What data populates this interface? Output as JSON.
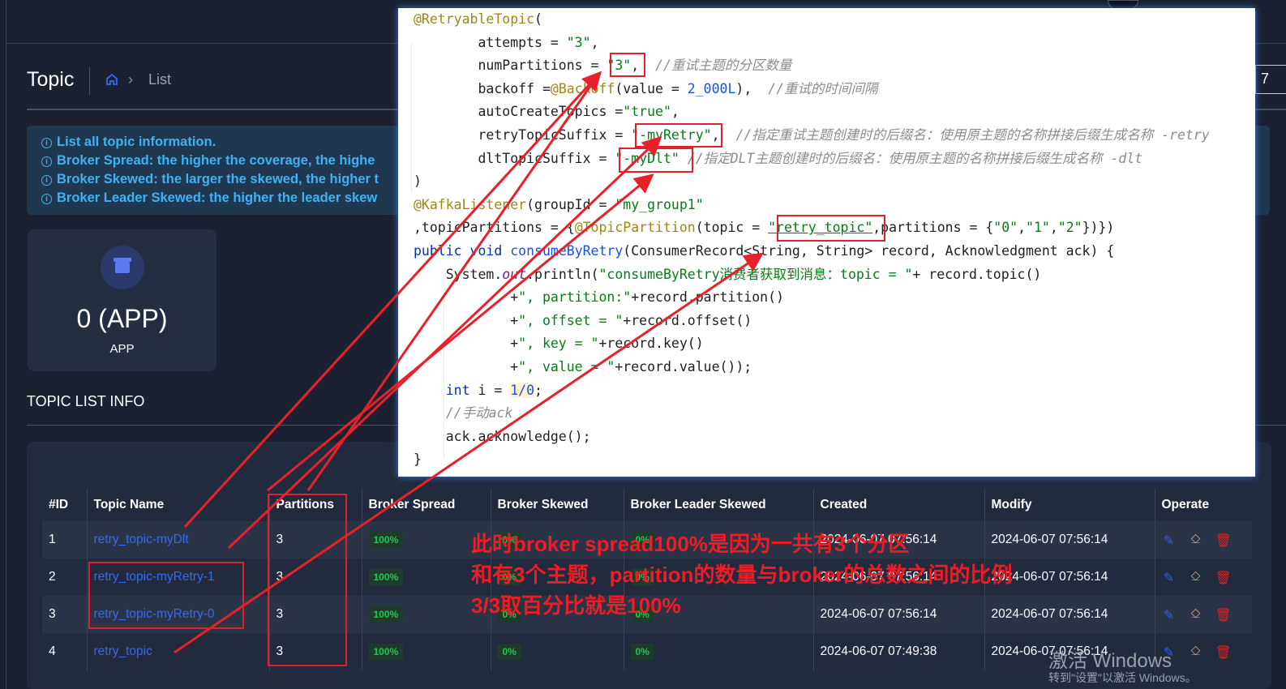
{
  "header": {
    "title": "Topic",
    "breadcrumb": [
      "home-icon",
      "List"
    ],
    "right_fragment": "7"
  },
  "alert": {
    "lines": [
      "List all topic information.",
      "Broker Spread: the higher the coverage, the highe",
      "Broker Skewed: the larger the skewed, the higher t",
      "Broker Leader Skewed: the higher the leader skew"
    ]
  },
  "app_card": {
    "value": "0 (APP)",
    "label": "APP",
    "icon": "archive-icon"
  },
  "section_title": "TOPIC LIST INFO",
  "table": {
    "columns": [
      "#ID",
      "Topic Name",
      "Partitions",
      "Broker Spread",
      "Broker Skewed",
      "Broker Leader Skewed",
      "Created",
      "Modify",
      "Operate"
    ],
    "rows": [
      {
        "id": "1",
        "name": "retry_topic-myDlt",
        "partitions": "3",
        "spread": "100%",
        "skewed": "0%",
        "leader_skewed": "0%",
        "created": "2024-06-07 07:56:14",
        "modify": "2024-06-07 07:56:14"
      },
      {
        "id": "2",
        "name": "retry_topic-myRetry-1",
        "partitions": "3",
        "spread": "100%",
        "skewed": "0%",
        "leader_skewed": "0%",
        "created": "2024-06-07 07:56:14",
        "modify": "2024-06-07 07:56:14"
      },
      {
        "id": "3",
        "name": "retry_topic-myRetry-0",
        "partitions": "3",
        "spread": "100%",
        "skewed": "0%",
        "leader_skewed": "0%",
        "created": "2024-06-07 07:56:14",
        "modify": "2024-06-07 07:56:14"
      },
      {
        "id": "4",
        "name": "retry_topic",
        "partitions": "3",
        "spread": "100%",
        "skewed": "0%",
        "leader_skewed": "0%",
        "created": "2024-06-07 07:49:38",
        "modify": "2024-06-07 07:56:14"
      }
    ],
    "operate_icons": [
      "edit-icon",
      "brush-icon",
      "delete-icon"
    ]
  },
  "code": {
    "lines": [
      [
        [
          "@RetryableTopic",
          "an"
        ],
        [
          "(",
          ""
        ]
      ],
      [
        [
          "        attempts = ",
          ""
        ],
        [
          "\"3\"",
          "s"
        ],
        [
          ",",
          ""
        ]
      ],
      [
        [
          "        numPartitions = ",
          ""
        ],
        [
          "\"3\"",
          "s"
        ],
        [
          ",  ",
          ""
        ],
        [
          "//重试主题的分区数量",
          "c"
        ]
      ],
      [
        [
          "        backoff =",
          ""
        ],
        [
          "@Backoff",
          "an"
        ],
        [
          "(value = ",
          ""
        ],
        [
          "2_000L",
          "n"
        ],
        [
          "),  ",
          ""
        ],
        [
          "//重试的时间间隔",
          "c"
        ]
      ],
      [
        [
          "        autoCreateTopics =",
          ""
        ],
        [
          "\"true\"",
          "s"
        ],
        [
          ",",
          ""
        ]
      ],
      [
        [
          "        retryTopicSuffix = ",
          ""
        ],
        [
          "\"-myRetry\"",
          "s"
        ],
        [
          ",  ",
          ""
        ],
        [
          "//指定重试主题创建时的后缀名：使用原主题的名称拼接后缀生成名称 -retry",
          "c"
        ]
      ],
      [
        [
          "        dltTopicSuffix = ",
          ""
        ],
        [
          "\"-myDlt\"",
          "s"
        ],
        [
          " ",
          ""
        ],
        [
          "//指定DLT主题创建时的后缀名：使用原主题的名称拼接后缀生成名称 -dlt",
          "c"
        ]
      ],
      [
        [
          ")",
          ""
        ]
      ],
      [
        [
          "@KafkaListener",
          "an"
        ],
        [
          "(groupId = ",
          ""
        ],
        [
          "\"my_group1\"",
          "s"
        ]
      ],
      [
        [
          ",topicPartitions = {",
          ""
        ],
        [
          "@TopicPartition",
          "an"
        ],
        [
          "(topic = ",
          ""
        ],
        [
          "\"retry_topic\"",
          "s ul"
        ],
        [
          ",partitions = {",
          ""
        ],
        [
          "\"0\"",
          "s"
        ],
        [
          ",",
          ""
        ],
        [
          "\"1\"",
          "s"
        ],
        [
          ",",
          ""
        ],
        [
          "\"2\"",
          "s"
        ],
        [
          "})})",
          ""
        ]
      ],
      [
        [
          "public void ",
          "k"
        ],
        [
          "consumeByRetry",
          "n"
        ],
        [
          "(ConsumerRecord<String, String> record, Acknowledgment ack) {",
          ""
        ]
      ],
      [
        [
          "    System.",
          ""
        ],
        [
          "out",
          "f"
        ],
        [
          ".println(",
          ""
        ],
        [
          "\"consumeByRetry消费者获取到消息：topic = \"",
          "s"
        ],
        [
          "+ record.topic()",
          ""
        ]
      ],
      [
        [
          "            +",
          ""
        ],
        [
          "\", partition:\"",
          "s"
        ],
        [
          "+record.partition()",
          ""
        ]
      ],
      [
        [
          "            +",
          ""
        ],
        [
          "\", offset = \"",
          "s"
        ],
        [
          "+record.offset()",
          ""
        ]
      ],
      [
        [
          "            +",
          ""
        ],
        [
          "\", key = \"",
          "s"
        ],
        [
          "+record.key()",
          ""
        ]
      ],
      [
        [
          "            +",
          ""
        ],
        [
          "\", value = \"",
          "s"
        ],
        [
          "+record.value());",
          ""
        ]
      ],
      [
        [
          "    ",
          ""
        ],
        [
          "int",
          "k"
        ],
        [
          " i = ",
          ""
        ],
        [
          "1/0",
          "n hl"
        ],
        [
          ";",
          ""
        ]
      ],
      [
        [
          "    ",
          ""
        ],
        [
          "//手动ack",
          "c"
        ]
      ],
      [
        [
          "    ack.acknowledge();",
          ""
        ]
      ],
      [
        [
          "}",
          ""
        ]
      ]
    ]
  },
  "annotation": {
    "lines": [
      "此时broker spread100%是因为一共有3个分区",
      "和有3个主题，partition的数量与broker的总数之间的比例",
      "3/3取百分比就是100%"
    ],
    "color": "#ee1c25"
  },
  "watermark": {
    "title": "激活 Windows",
    "subtitle": "转到\"设置\"以激活 Windows。"
  }
}
